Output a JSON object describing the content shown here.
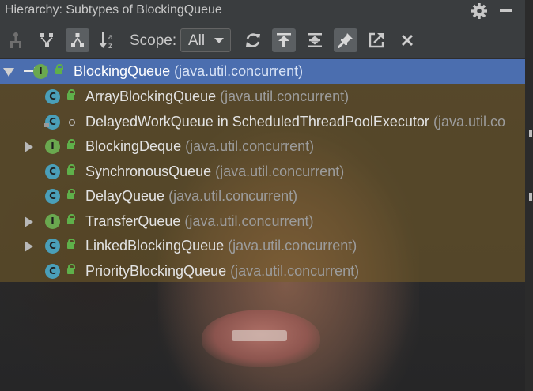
{
  "window": {
    "title": "Hierarchy:  Subtypes of BlockingQueue"
  },
  "toolbar": {
    "scope_label": "Scope:",
    "scope_value": "All",
    "buttons": [
      {
        "icon": "supertype-hierarchy-icon",
        "selected": false
      },
      {
        "icon": "class-hierarchy-icon",
        "selected": false
      },
      {
        "icon": "subtype-hierarchy-icon",
        "selected": true
      },
      {
        "icon": "sort-alphabetically-icon",
        "selected": false
      },
      {
        "icon": "refresh-icon",
        "selected": false
      },
      {
        "icon": "scroll-from-source-icon",
        "selected": true
      },
      {
        "icon": "expand-all-icon",
        "selected": false
      },
      {
        "icon": "pin-icon",
        "selected": true
      },
      {
        "icon": "open-in-new-window-icon",
        "selected": false
      },
      {
        "icon": "close-icon",
        "selected": false
      }
    ]
  },
  "tree": {
    "rows": [
      {
        "name": "BlockingQueue",
        "package": "(java.util.concurrent)",
        "kind": "interface",
        "expanded": true,
        "selected": true
      },
      {
        "name": "ArrayBlockingQueue",
        "package": "(java.util.concurrent)",
        "kind": "class"
      },
      {
        "name": "DelayedWorkQueue in ScheduledThreadPoolExecutor",
        "package": "(java.util.co",
        "kind": "class"
      },
      {
        "name": "BlockingDeque",
        "package": "(java.util.concurrent)",
        "kind": "interface",
        "expandable": true
      },
      {
        "name": "SynchronousQueue",
        "package": "(java.util.concurrent)",
        "kind": "class"
      },
      {
        "name": "DelayQueue",
        "package": "(java.util.concurrent)",
        "kind": "class"
      },
      {
        "name": "TransferQueue",
        "package": "(java.util.concurrent)",
        "kind": "interface",
        "expandable": true
      },
      {
        "name": "LinkedBlockingQueue",
        "package": "(java.util.concurrent)",
        "kind": "class",
        "expandable": true
      },
      {
        "name": "PriorityBlockingQueue",
        "package": "(java.util.concurrent)",
        "kind": "class"
      }
    ]
  },
  "colors": {
    "selection": "#4b6eaf",
    "class_badge": "#4a9fb9",
    "interface_badge": "#6aa84f"
  }
}
